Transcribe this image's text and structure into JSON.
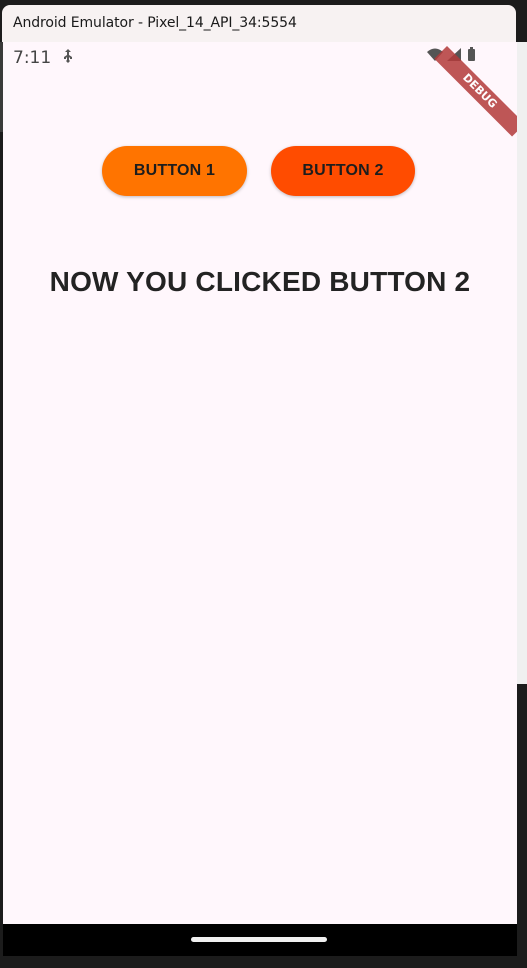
{
  "window": {
    "title": "Android Emulator - Pixel_14_API_34:5554"
  },
  "status_bar": {
    "time": "7:11",
    "icons": [
      "usb-debug-icon",
      "wifi-icon",
      "cell-signal-icon",
      "battery-icon"
    ],
    "debug_banner": "DEBUG"
  },
  "buttons": [
    {
      "label": "BUTTON 1",
      "color": "#ff7400"
    },
    {
      "label": "BUTTON 2",
      "color": "#ff4c00"
    }
  ],
  "message": "NOW YOU CLICKED BUTTON 2",
  "colors": {
    "screen_background": "#fff7fc",
    "text": "#232323"
  }
}
